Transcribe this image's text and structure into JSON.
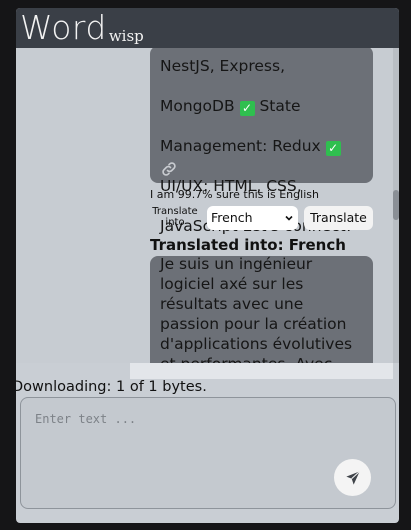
{
  "app": {
    "logo_main": "Word",
    "logo_sub": "wisp"
  },
  "messages": [
    {
      "role": "user",
      "text_lines": [
        "NestJS, Express,",
        "MongoDB",
        "State",
        "Management: Redux",
        "UI/UX: HTML, CSS,",
        "JavaScript Let's connect!"
      ]
    }
  ],
  "detection": {
    "text": "I am 99.7% sure this is English"
  },
  "translate": {
    "label": "Translate into",
    "selected_language": "French",
    "button_label": "Translate"
  },
  "translation": {
    "title": "Translated into: French",
    "text": "Je suis un ingénieur\nlogiciel axé sur les\nrésultats avec une\npassion pour la création\nd'applications évolutives\net performantes. Avec"
  },
  "status": {
    "text": "Downloading: 1 of 1 bytes."
  },
  "input": {
    "placeholder": "Enter text ..."
  },
  "icons": {
    "checkmark": "check-icon",
    "link": "link-icon",
    "send": "send-icon",
    "dropdown": "chevron-down-icon"
  },
  "colors": {
    "header": "#3a3f47",
    "bubble": "#6c7077",
    "check": "#2fbf4f"
  }
}
